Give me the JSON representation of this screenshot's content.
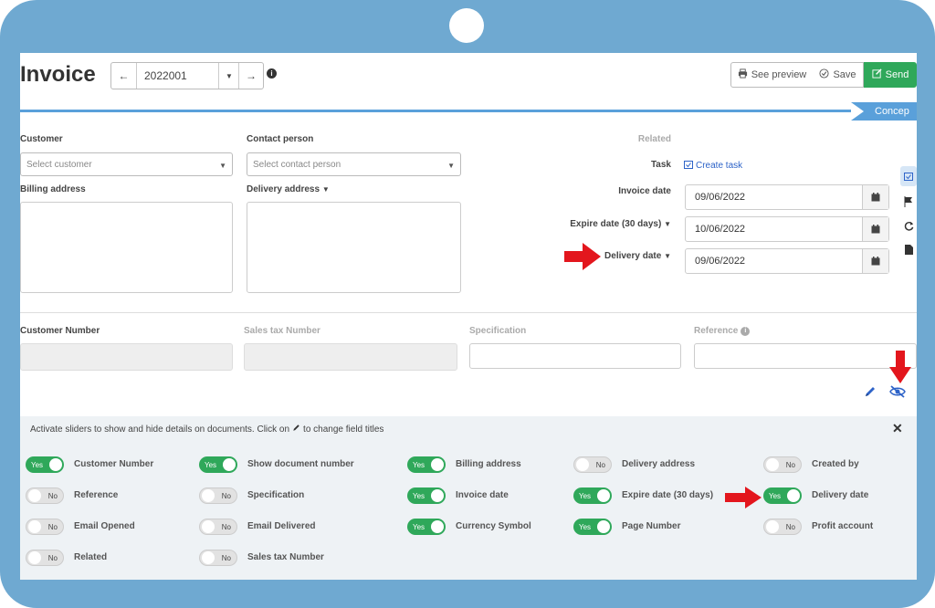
{
  "page": {
    "title": "Invoice",
    "doc_number": "2022001",
    "status_tag": "Concep",
    "buttons": {
      "preview": "See preview",
      "save": "Save",
      "send": "Send"
    }
  },
  "form": {
    "customer": {
      "label": "Customer",
      "placeholder": "Select customer"
    },
    "contact": {
      "label": "Contact person",
      "placeholder": "Select contact person"
    },
    "billing_label": "Billing address",
    "delivery_address_label": "Delivery address",
    "related_label": "Related",
    "task_label": "Task",
    "create_task": "Create task",
    "invoice_date": {
      "label": "Invoice date",
      "value": "09/06/2022"
    },
    "expire_date": {
      "label": "Expire date (30 days)",
      "value": "10/06/2022"
    },
    "delivery_date": {
      "label": "Delivery date",
      "value": "09/06/2022"
    },
    "customer_number_label": "Customer Number",
    "sales_tax_label": "Sales tax Number",
    "specification_label": "Specification",
    "reference_label": "Reference"
  },
  "panel": {
    "instruction_prefix": "Activate sliders to show and hide details on documents. Click on",
    "instruction_suffix": "to change field titles",
    "toggles": [
      {
        "label": "Customer Number",
        "state": "Yes",
        "on": true
      },
      {
        "label": "Show document number",
        "state": "Yes",
        "on": true
      },
      {
        "label": "Billing address",
        "state": "Yes",
        "on": true
      },
      {
        "label": "Delivery address",
        "state": "No",
        "on": false
      },
      {
        "label": "Created by",
        "state": "No",
        "on": false
      },
      {
        "label": "Reference",
        "state": "No",
        "on": false
      },
      {
        "label": "Specification",
        "state": "No",
        "on": false
      },
      {
        "label": "Invoice date",
        "state": "Yes",
        "on": true
      },
      {
        "label": "Expire date (30 days)",
        "state": "Yes",
        "on": true
      },
      {
        "label": "Delivery date",
        "state": "Yes",
        "on": true
      },
      {
        "label": "Email Opened",
        "state": "No",
        "on": false
      },
      {
        "label": "Email Delivered",
        "state": "No",
        "on": false
      },
      {
        "label": "Currency Symbol",
        "state": "Yes",
        "on": true
      },
      {
        "label": "Page Number",
        "state": "Yes",
        "on": true
      },
      {
        "label": "Profit account",
        "state": "No",
        "on": false
      },
      {
        "label": "Related",
        "state": "No",
        "on": false
      },
      {
        "label": "Sales tax Number",
        "state": "No",
        "on": false
      }
    ]
  },
  "colors": {
    "frame": "#6fa9d1",
    "accent": "#5aa0da",
    "success": "#2fa85a",
    "annotation_arrow": "#e3161d",
    "icon_blue": "#2d63c8"
  }
}
